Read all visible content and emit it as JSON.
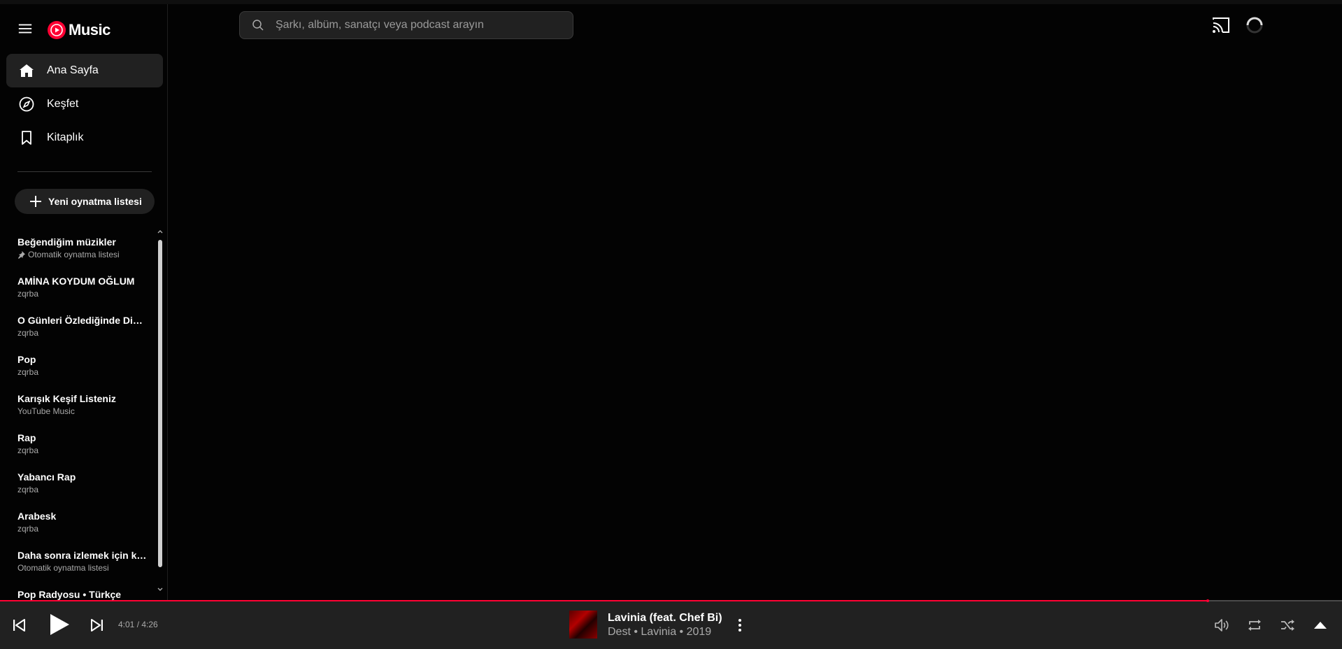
{
  "app": {
    "logo_text": "Music"
  },
  "nav": {
    "items": [
      {
        "label": "Ana Sayfa",
        "icon": "home-icon",
        "active": true
      },
      {
        "label": "Keşfet",
        "icon": "compass-icon",
        "active": false
      },
      {
        "label": "Kitaplık",
        "icon": "bookmark-icon",
        "active": false
      }
    ]
  },
  "sidebar": {
    "new_playlist_label": "Yeni oynatma listesi",
    "playlists": [
      {
        "title": "Beğendiğim müzikler",
        "subtitle": "Otomatik oynatma listesi",
        "pinned": true
      },
      {
        "title": "AMİNA KOYDUM OĞLUM",
        "subtitle": "zqrba"
      },
      {
        "title": "O Günleri Özlediğinde Dinl...",
        "subtitle": "zqrba"
      },
      {
        "title": "Pop",
        "subtitle": "zqrba"
      },
      {
        "title": "Karışık Keşif Listeniz",
        "subtitle": "YouTube Music"
      },
      {
        "title": "Rap",
        "subtitle": "zqrba"
      },
      {
        "title": "Yabancı Rap",
        "subtitle": "zqrba"
      },
      {
        "title": "Arabesk",
        "subtitle": "zqrba"
      },
      {
        "title": "Daha sonra izlemek için ka...",
        "subtitle": "Otomatik oynatma listesi"
      },
      {
        "title": "Pop Radyosu • Türkçe",
        "subtitle": ""
      }
    ]
  },
  "search": {
    "placeholder": "Şarkı, albüm, sanatçı veya podcast arayın"
  },
  "player": {
    "time": "4:01 / 4:26",
    "progress": 0.9,
    "song_title": "Lavinia (feat. Chef Bi)",
    "song_subtitle": "Dest • Lavinia • 2019"
  },
  "colors": {
    "accent": "#ff0033",
    "background": "#030303",
    "player_bg": "#212121"
  }
}
